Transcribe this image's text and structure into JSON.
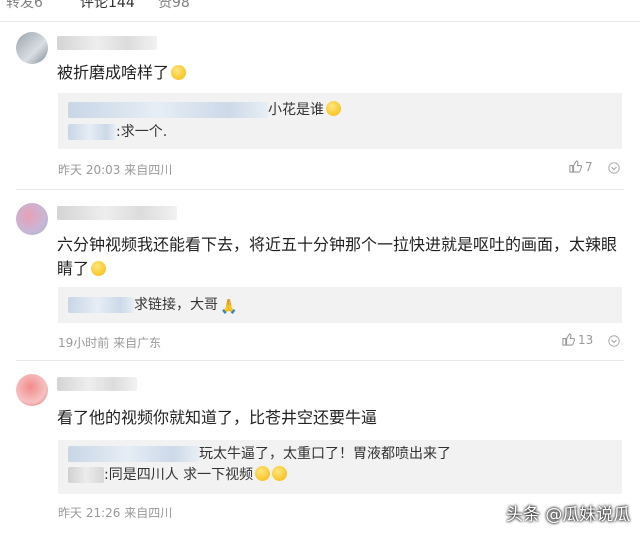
{
  "tabs": [
    "转发6",
    "评论144",
    "赞98"
  ],
  "comments": [
    {
      "text": "被折磨成啥样了",
      "replies": [
        "小花是谁",
        ":求一个."
      ],
      "time": "昨天 20:03",
      "location": "来自四川",
      "likes": "7"
    },
    {
      "text": "六分钟视频我还能看下去，将近五十分钟那个一拉快进就是呕吐的画面，太辣眼睛了",
      "replies": [
        "求链接，大哥"
      ],
      "time": "19小时前",
      "location": "来自广东",
      "likes": "13"
    },
    {
      "text": "看了他的视频你就知道了，比苍井空还要牛逼",
      "replies": [
        "玩太牛逼了，太重口了！胃液都喷出来了",
        ":同是四川人 求一下视频"
      ],
      "time": "昨天 21:26",
      "location": "来自四川",
      "likes": ""
    }
  ],
  "watermark": "头条 @瓜妹说瓜",
  "colors": {
    "reply_bg": "#f2f2f2",
    "meta": "#999999",
    "accent": "#333333"
  }
}
